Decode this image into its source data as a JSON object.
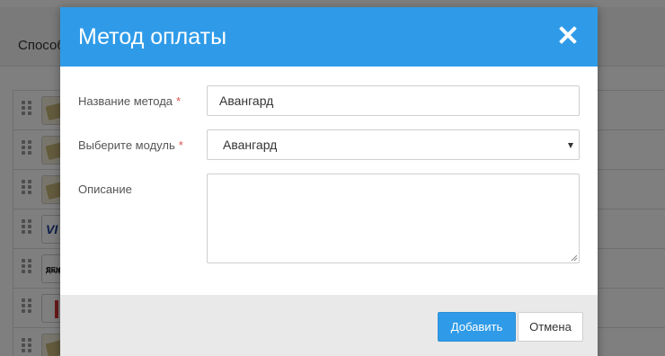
{
  "background": {
    "section_title": "Способ",
    "rows": [
      {
        "icon": "cash-icon"
      },
      {
        "icon": "cash-icon"
      },
      {
        "icon": "cash-icon"
      },
      {
        "icon": "visa-icon",
        "label": "VI"
      },
      {
        "icon": "yandex-money-icon",
        "label_top": "Яндекс",
        "label_bottom": "ДЕНЬ"
      },
      {
        "icon": "red-logo-icon"
      },
      {
        "icon": "cash-icon"
      }
    ]
  },
  "modal": {
    "title": "Метод оплаты",
    "close_icon": "close-icon",
    "fields": {
      "method_name": {
        "label": "Название метода",
        "required_mark": "*",
        "value": "Авангард"
      },
      "module": {
        "label": "Выберите модуль",
        "required_mark": "*",
        "selected": "Авангард"
      },
      "description": {
        "label": "Описание",
        "value": ""
      }
    },
    "buttons": {
      "add": "Добавить",
      "cancel": "Отмена"
    }
  },
  "colors": {
    "accent": "#2f9be8",
    "required": "#d9534f",
    "footer_bg": "#e9e9e9"
  }
}
